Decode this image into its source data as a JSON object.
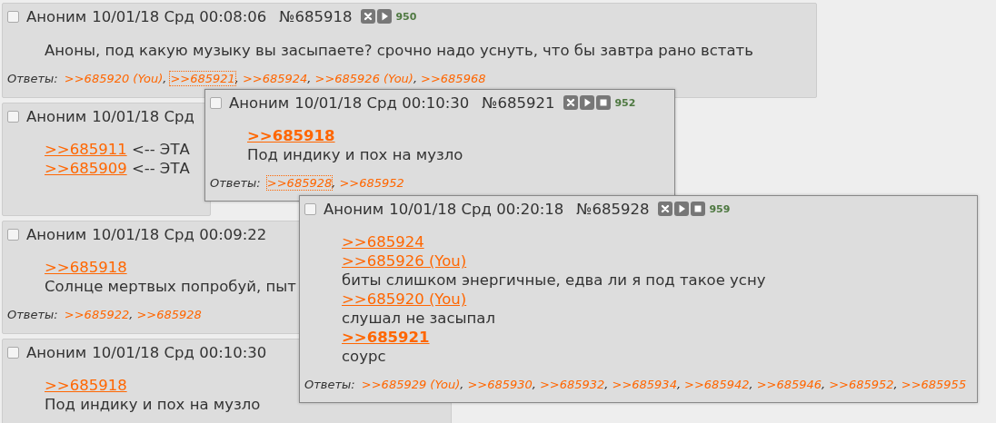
{
  "posts": [
    {
      "name": "Аноним",
      "date": "10/01/18 Срд 00:08:06",
      "number": "№685918",
      "icons": [
        {
          "kind": "hide"
        },
        {
          "kind": "play"
        }
      ],
      "count": "950",
      "checked": false,
      "lines": [
        {
          "text": "Аноны, под какую музыку вы засыпаете? срочно надо уснуть, что бы завтра рано встать"
        }
      ],
      "replies_label": "Ответы:",
      "separator": ",",
      "replies": [
        {
          "text": ">>685920 (You)",
          "selected": false
        },
        {
          "text": ">>685921",
          "selected": true
        },
        {
          "text": ">>685924",
          "selected": false
        },
        {
          "text": ">>685926 (You)",
          "selected": false
        },
        {
          "text": ">>685968",
          "selected": false
        }
      ]
    },
    {
      "name": "Аноним",
      "date": "10/01/18 Срд",
      "checked": false,
      "lines": [
        {
          "link": {
            "text": ">>685911",
            "bold": false
          },
          "text": " <-- ЭТА"
        },
        {
          "link": {
            "text": ">>685909",
            "bold": false
          },
          "text": " <-- ЭТА"
        }
      ]
    },
    {
      "name": "Аноним",
      "date": "10/01/18 Срд 00:09:22",
      "checked": false,
      "lines": [
        {
          "link": {
            "text": ">>685918",
            "bold": false
          }
        },
        {
          "text": "Солнце мертвых попробуй, пыт"
        }
      ],
      "replies_label": "Ответы:",
      "separator": ",",
      "replies": [
        {
          "text": ">>685922",
          "selected": false
        },
        {
          "text": ">>685928",
          "selected": false
        }
      ]
    },
    {
      "name": "Аноним",
      "date": "10/01/18 Срд 00:10:30",
      "checked": false,
      "lines": [
        {
          "link": {
            "text": ">>685918",
            "bold": false
          }
        },
        {
          "text": "Под индику и пох на музло"
        }
      ]
    }
  ],
  "popups": [
    {
      "name": "Аноним",
      "date": "10/01/18 Срд 00:10:30",
      "number": "№685921",
      "icons": [
        {
          "kind": "hide"
        },
        {
          "kind": "play"
        },
        {
          "kind": "stop"
        }
      ],
      "count": "952",
      "checked": false,
      "lines": [
        {
          "link": {
            "text": ">>685918",
            "bold": true
          }
        },
        {
          "text": "Под индику и пох на музло"
        }
      ],
      "replies_label": "Ответы:",
      "separator": ",",
      "replies": [
        {
          "text": ">>685928",
          "selected": true
        },
        {
          "text": ">>685952",
          "selected": false
        }
      ]
    },
    {
      "name": "Аноним",
      "date": "10/01/18 Срд 00:20:18",
      "number": "№685928",
      "icons": [
        {
          "kind": "hide"
        },
        {
          "kind": "play"
        },
        {
          "kind": "stop"
        }
      ],
      "count": "959",
      "checked": false,
      "lines": [
        {
          "link": {
            "text": ">>685924",
            "bold": false
          }
        },
        {
          "link": {
            "text": ">>685926 (You)",
            "bold": false
          }
        },
        {
          "text": "биты слишком энергичные, едва ли я под такое усну"
        },
        {
          "link": {
            "text": ">>685920 (You)",
            "bold": false
          }
        },
        {
          "text": "слушал не засыпал"
        },
        {
          "link": {
            "text": ">>685921",
            "bold": true
          }
        },
        {
          "text": "соурс"
        }
      ],
      "replies_label": "Ответы:",
      "separator": ",",
      "replies": [
        {
          "text": ">>685929 (You)",
          "selected": false
        },
        {
          "text": ">>685930",
          "selected": false
        },
        {
          "text": ">>685932",
          "selected": false
        },
        {
          "text": ">>685934",
          "selected": false
        },
        {
          "text": ">>685942",
          "selected": false
        },
        {
          "text": ">>685946",
          "selected": false
        },
        {
          "text": ">>685952",
          "selected": false
        },
        {
          "text": ">>685955",
          "selected": false
        }
      ]
    }
  ]
}
